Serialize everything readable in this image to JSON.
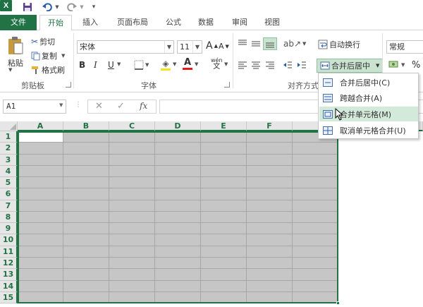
{
  "quick_access": {
    "app_icon": "X",
    "icons": [
      "excel-logo",
      "save-icon",
      "undo-icon",
      "redo-icon",
      "customize-icon"
    ]
  },
  "tabs": [
    {
      "label": "文件"
    },
    {
      "label": "开始"
    },
    {
      "label": "插入"
    },
    {
      "label": "页面布局"
    },
    {
      "label": "公式"
    },
    {
      "label": "数据"
    },
    {
      "label": "审阅"
    },
    {
      "label": "视图"
    }
  ],
  "clipboard": {
    "paste_label": "粘贴",
    "cut_label": "剪切",
    "copy_label": "复制",
    "format_painter_label": "格式刷",
    "group_label": "剪贴板"
  },
  "font": {
    "font_name": "宋体",
    "font_size": "11",
    "bold": "B",
    "italic": "I",
    "underline": "U",
    "grow": "A",
    "shrink": "A",
    "phonetic_top": "wén",
    "phonetic_bottom": "文",
    "group_label": "字体",
    "font_color": "#e11b1b",
    "fill_color": "#f4e41a"
  },
  "alignment": {
    "wrap_text_label": "自动换行",
    "merge_center_label": "合并后居中",
    "group_label": "对齐方式"
  },
  "number": {
    "format": "常规",
    "percent": "%"
  },
  "formula_bar": {
    "name_box": "A1",
    "fx": "fx"
  },
  "merge_menu": {
    "items": [
      {
        "label": "合并后居中(C)"
      },
      {
        "label": "跨越合并(A)"
      },
      {
        "label": "合并单元格(M)"
      },
      {
        "label": "取消单元格合并(U)"
      }
    ]
  },
  "sheet": {
    "columns": [
      "A",
      "B",
      "C",
      "D",
      "E",
      "F",
      "G"
    ],
    "rows": [
      "1",
      "2",
      "3",
      "4",
      "5",
      "6",
      "7",
      "8",
      "9",
      "10",
      "11",
      "12",
      "13",
      "14",
      "15"
    ],
    "active_cell": "A1"
  },
  "colors": {
    "accent": "#217346",
    "selection_fill": "#c6c6c6",
    "menu_hover": "#d3eadb"
  }
}
